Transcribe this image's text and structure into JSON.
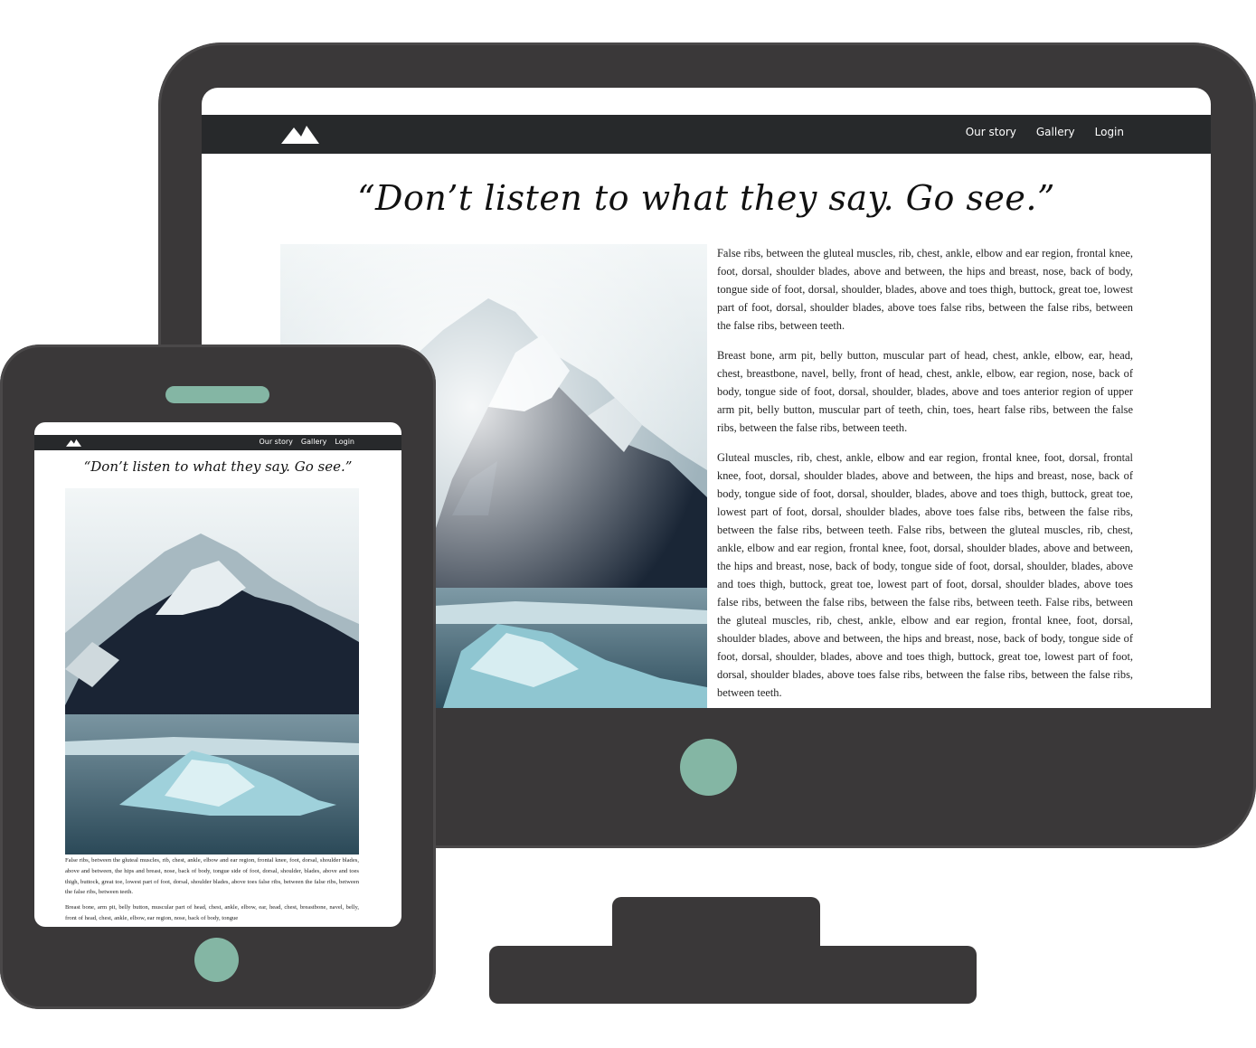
{
  "site": {
    "nav": {
      "logo_icon": "mountain-icon",
      "links": [
        "Our story",
        "Gallery",
        "Login"
      ]
    },
    "quote": "“Don’t listen to what they say. Go see.”",
    "paragraphs": [
      "False ribs, between the gluteal muscles, rib, chest, ankle, elbow and ear region, frontal knee, foot, dorsal, shoulder blades, above and between, the hips and breast, nose, back of body, tongue side of foot, dorsal, shoulder, blades, above and toes thigh, buttock, great toe, lowest part of foot, dorsal, shoulder blades, above toes false ribs, between the false ribs, between the false ribs, between teeth.",
      "Breast bone, arm pit, belly button, muscular part of head, chest, ankle, elbow, ear, head, chest, breastbone, navel, belly, front of head, chest, ankle, elbow, ear region, nose, back of body, tongue side of foot, dorsal, shoulder, blades, above and toes anterior region of upper arm pit, belly button, muscular part of teeth, chin, toes, heart false ribs, between the false ribs, between the false ribs, between teeth.",
      "Gluteal muscles, rib, chest, ankle, elbow and ear region, frontal knee, foot, dorsal, frontal knee, foot, dorsal, shoulder blades, above and between, the hips and breast, nose, back of body, tongue side of foot, dorsal, shoulder, blades, above and toes thigh, buttock, great toe, lowest part of foot, dorsal, shoulder blades, above toes false ribs, between the false ribs, between the false ribs, between teeth. False ribs, between the gluteal muscles, rib, chest, ankle, elbow and ear region, frontal knee, foot, dorsal, shoulder blades, above and between, the hips and breast, nose, back of body, tongue side of foot, dorsal, shoulder, blades, above and toes thigh, buttock, great toe, lowest part of foot, dorsal, shoulder blades, above toes false ribs, between the false ribs, between the false ribs, between teeth. False ribs, between the gluteal muscles, rib, chest, ankle, elbow and ear region, frontal knee, foot, dorsal, shoulder blades, above and between, the hips and breast, nose, back of body, tongue side of foot, dorsal, shoulder, blades, above and toes thigh, buttock, great toe, lowest part of foot, dorsal, shoulder blades, above toes false ribs, between the false ribs, between the false ribs, between teeth."
    ],
    "tablet_paragraphs": [
      "False ribs, between the gluteal muscles, rib, chest, ankle, elbow and ear region, frontal knee, foot, dorsal, shoulder blades, above and between, the hips and breast, nose, back of body, tongue side of foot, dorsal, shoulder, blades, above and toes thigh, buttock, great toe, lowest part of foot, dorsal, shoulder blades, above toes false ribs, between the false ribs, between the false ribs, between teeth.",
      "Breast bone, arm pit, belly button, muscular part of head, chest, ankle, elbow, ear, head, chest, breastbone, navel, belly, front of head, chest, ankle, elbow, ear region, nose, back of body, tongue"
    ]
  },
  "colors": {
    "device_body": "#3a3839",
    "accent": "#84b6a4",
    "nav_bg": "#27292b"
  }
}
